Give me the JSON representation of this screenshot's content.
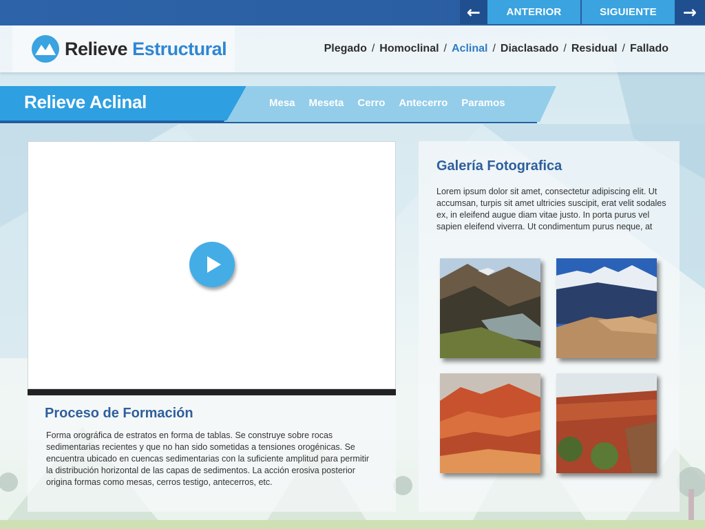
{
  "top_nav": {
    "prev_label": "ANTERIOR",
    "next_label": "SIGUIENTE",
    "prev_icon": "arrow-left-icon",
    "next_icon": "arrow-right-icon"
  },
  "logo": {
    "word1": "Relieve",
    "word2": "Estructural",
    "icon": "mountain-icon"
  },
  "main_nav": {
    "items": [
      "Plegado",
      "Homoclinal",
      "Aclinal",
      "Diaclasado",
      "Residual",
      "Fallado"
    ],
    "active": "Aclinal",
    "separator": "/"
  },
  "section": {
    "title": "Relieve Aclinal",
    "tabs": [
      "Mesa",
      "Meseta",
      "Cerro",
      "Antecerro",
      "Paramos"
    ]
  },
  "video": {
    "play_icon": "play-icon"
  },
  "process": {
    "title": "Proceso de Formación",
    "text": "Forma orográfica de estratos en forma de tablas. Se construye sobre rocas sedimentarias recientes y que no han sido sometidas a tensiones orogénicas. Se encuentra ubicado en cuencas sedimentarias con la suficiente amplitud para permitir la distribución horizontal de las capas de sedimentos. La acción erosiva posterior origina formas como mesas, cerros testigo, antecerros, etc."
  },
  "gallery": {
    "title": "Galería Fotografica",
    "text": "Lorem ipsum dolor sit amet, consectetur adipiscing elit. Ut accumsan, turpis sit amet ultricies suscipit, erat velit sodales ex, in eleifend augue diam vitae justo. In porta purus vel sapien eleifend viverra. Ut condimentum purus neque, at"
  },
  "colors": {
    "top_bar": "#2d63a8",
    "accent_blue": "#2e9fe0",
    "title_blue": "#2f5f9c",
    "active_nav": "#2f7cc4"
  }
}
